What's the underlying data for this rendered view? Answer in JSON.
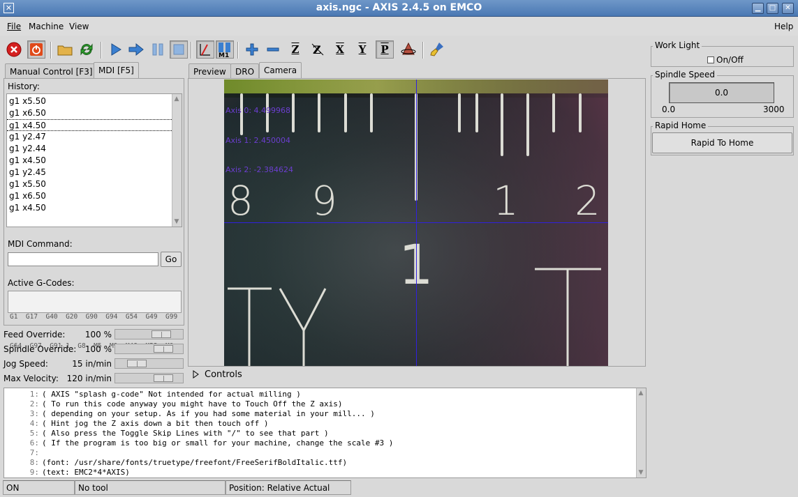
{
  "window": {
    "title": "axis.ngc - AXIS 2.4.5 on EMCO",
    "icon": "x-icon"
  },
  "menu": {
    "file": "File",
    "machine": "Machine",
    "view": "View",
    "help": "Help"
  },
  "left_tabs": [
    "Manual Control [F3]",
    "MDI [F5]"
  ],
  "history": {
    "label": "History:",
    "items": [
      "g1 x5.50",
      "g1 x6.50",
      "g1 x4.50",
      "g1 y2.47",
      "g1 y2.44",
      "g1 x4.50",
      "g1 y2.45",
      "g1 x5.50",
      "g1 x6.50",
      "g1 x4.50"
    ],
    "selected_index": 2
  },
  "mdi": {
    "label": "MDI Command:",
    "value": "",
    "go": "Go"
  },
  "gcodes": {
    "label": "Active G-Codes:",
    "line1": "G1  G17  G40  G20  G90  G94  G54  G49  G99",
    "line2": "G64  G97  G91.1  G8  M5  M9  M48  M53  M0"
  },
  "overrides": [
    {
      "label": "Feed Override:",
      "value": "100 %",
      "fraction": 0.75
    },
    {
      "label": "Spindle Override:",
      "value": "100 %",
      "fraction": 0.8
    },
    {
      "label": "Jog Speed:",
      "value": "15 in/min",
      "fraction": 0.25
    },
    {
      "label": "Max Velocity:",
      "value": "120 in/min",
      "fraction": 0.8
    }
  ],
  "view_tabs": [
    "Preview",
    "DRO",
    "Camera"
  ],
  "camera": {
    "axis0": "Axis 0: 4.499968",
    "axis1": "Axis 1: 2.450004",
    "axis2": "Axis 2: -2.384624",
    "scale_numbers": [
      "8",
      "9",
      "1",
      "2"
    ],
    "big_number": "1",
    "letters": [
      "T",
      "Y",
      "T"
    ]
  },
  "controls": {
    "label": "Controls"
  },
  "gcode_lines": [
    {
      "n": "1:",
      "text": "( AXIS \"splash g-code\" Not intended for actual milling )"
    },
    {
      "n": "2:",
      "text": "( To run this code anyway you might have to Touch Off the Z axis)"
    },
    {
      "n": "3:",
      "text": "( depending on your setup. As if you had some material in your mill... )"
    },
    {
      "n": "4:",
      "text": "( Hint jog the Z axis down a bit then touch off )"
    },
    {
      "n": "5:",
      "text": "( Also press the Toggle Skip Lines with \"/\" to see that part )"
    },
    {
      "n": "6:",
      "text": "( If the program is too big or small for your machine, change the scale #3 )"
    },
    {
      "n": "7:",
      "text": ""
    },
    {
      "n": "8:",
      "text": "(font: /usr/share/fonts/truetype/freefont/FreeSerifBoldItalic.ttf)"
    },
    {
      "n": "9:",
      "text": "(text: EMC2*4*AXIS)"
    }
  ],
  "right": {
    "work_light": {
      "title": "Work Light",
      "checkbox": "On/Off"
    },
    "spindle_speed": {
      "title": "Spindle Speed",
      "value": "0.0",
      "min": "0.0",
      "max": "3000"
    },
    "rapid_home": {
      "title": "Rapid Home",
      "button": "Rapid To Home"
    }
  },
  "status": {
    "state": "ON",
    "tool": "No tool",
    "position": "Position: Relative Actual"
  },
  "toolbar_icons": [
    "estop-icon",
    "power-icon",
    "open-folder-icon",
    "reload-icon",
    "run-icon",
    "step-icon",
    "pause-icon",
    "stop-icon",
    "skip-lines-icon",
    "optional-stop-icon",
    "zoom-in-icon",
    "zoom-out-icon",
    "view-z-icon",
    "view-z2-icon",
    "view-x-icon",
    "view-y-icon",
    "view-p-icon",
    "rotate-icon",
    "clear-plot-icon"
  ],
  "toolbar_glyphs": {
    "z": "Z",
    "x": "X",
    "y": "Y",
    "p": "P",
    "m1": "M1"
  },
  "colors": {
    "titlebar": "#5a84bb",
    "camera_overlay": "#6b3ecf",
    "crosshair": "#3020e0"
  }
}
